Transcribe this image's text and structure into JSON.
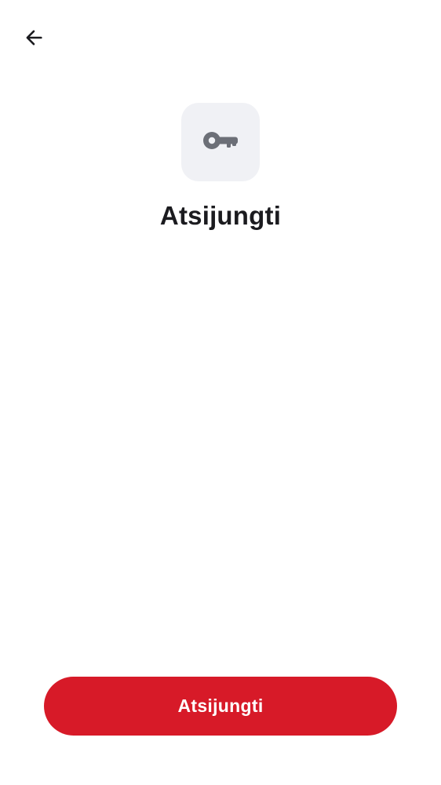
{
  "header": {
    "back_icon": "arrow-left-icon"
  },
  "hero": {
    "icon": "key-icon",
    "tile_color": "#f0f1f5",
    "icon_color": "#6c6f77",
    "title": "Atsijungti"
  },
  "actions": {
    "primary_label": "Atsijungti",
    "primary_color": "#d71a28"
  }
}
